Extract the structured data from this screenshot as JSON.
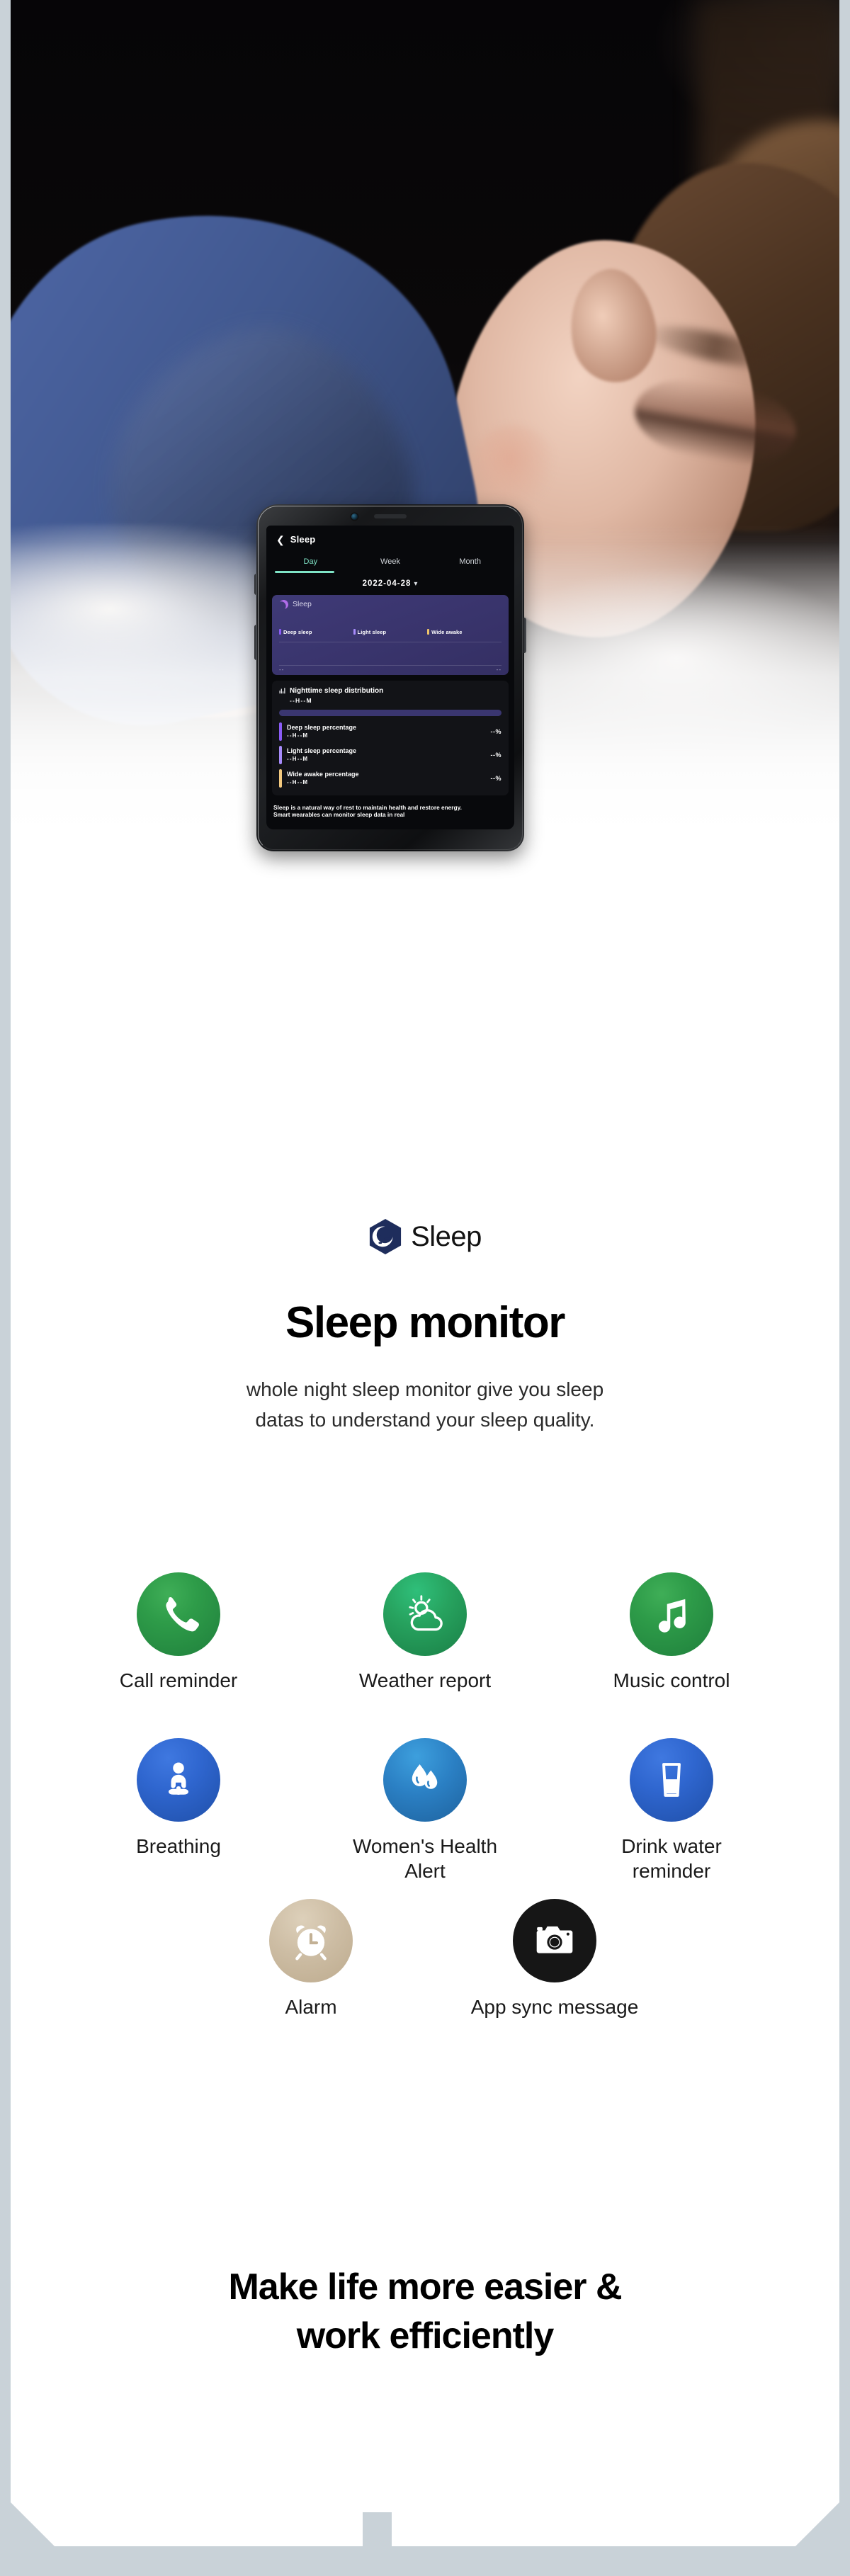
{
  "hero": {
    "alt": "woman sleeping on a pillow in a dark bedroom"
  },
  "phone": {
    "screen": {
      "header": {
        "back_icon": "chevron-left-icon",
        "title": "Sleep"
      },
      "tabs": [
        {
          "label": "Day",
          "active": true
        },
        {
          "label": "Week",
          "active": false
        },
        {
          "label": "Month",
          "active": false
        }
      ],
      "date_selector": {
        "value": "2022-04-28",
        "chevron": "⌄"
      },
      "sleep_card": {
        "icon": "moon-icon",
        "title": "Sleep",
        "legend": [
          {
            "label": "Deep sleep",
            "color": "#8b5cf6"
          },
          {
            "label": "Light sleep",
            "color": "#a78bfa"
          },
          {
            "label": "Wide awake",
            "color": "#f0c56a"
          }
        ],
        "axis_start": "--",
        "axis_end": "--"
      },
      "distribution_card": {
        "icon": "bar-chart-icon",
        "title": "Nighttime sleep distribution",
        "total": "--H--M",
        "rows": [
          {
            "label": "Deep sleep percentage",
            "duration": "--H--M",
            "percent": "--%",
            "color": "#8b5cf6"
          },
          {
            "label": "Light sleep percentage",
            "duration": "--H--M",
            "percent": "--%",
            "color": "#a78bfa"
          },
          {
            "label": "Wide awake percentage",
            "duration": "--H--M",
            "percent": "--%",
            "color": "#f3c97f"
          }
        ]
      },
      "footer_text": "Sleep is a natural way of rest to maintain health and restore energy.\n Smart wearables can monitor sleep data in real"
    }
  },
  "brand": {
    "logo_icon": "sleep-hexagon-logo",
    "name": "Sleep"
  },
  "headline": "Sleep monitor",
  "subheadline": "whole night sleep monitor give you sleep\ndatas to understand your sleep quality.",
  "features": [
    {
      "label": "Call reminder",
      "icon": "phone-icon",
      "style": "green"
    },
    {
      "label": "Weather report",
      "icon": "sun-cloud-icon",
      "style": "green2"
    },
    {
      "label": "Music control",
      "icon": "music-note-icon",
      "style": "green"
    },
    {
      "label": "Breathing",
      "icon": "meditation-icon",
      "style": "blue"
    },
    {
      "label": "Women's Health\nAlert",
      "icon": "water-drops-icon",
      "style": "blue2"
    },
    {
      "label": "Drink water\nreminder",
      "icon": "water-glass-icon",
      "style": "blue"
    },
    {
      "label": "Alarm",
      "icon": "alarm-clock-icon",
      "style": "tan"
    },
    {
      "label": "App sync message",
      "icon": "camera-icon",
      "style": "black"
    }
  ],
  "tagline": "Make life more easier &\nwork efficiently",
  "colors": {
    "page_border": "#c9d2d8",
    "sheet": "#ffffff",
    "accent_teal": "#7fe3c6",
    "card_purple": "#3f3a77",
    "brand_navy": "#1e2d5c"
  }
}
